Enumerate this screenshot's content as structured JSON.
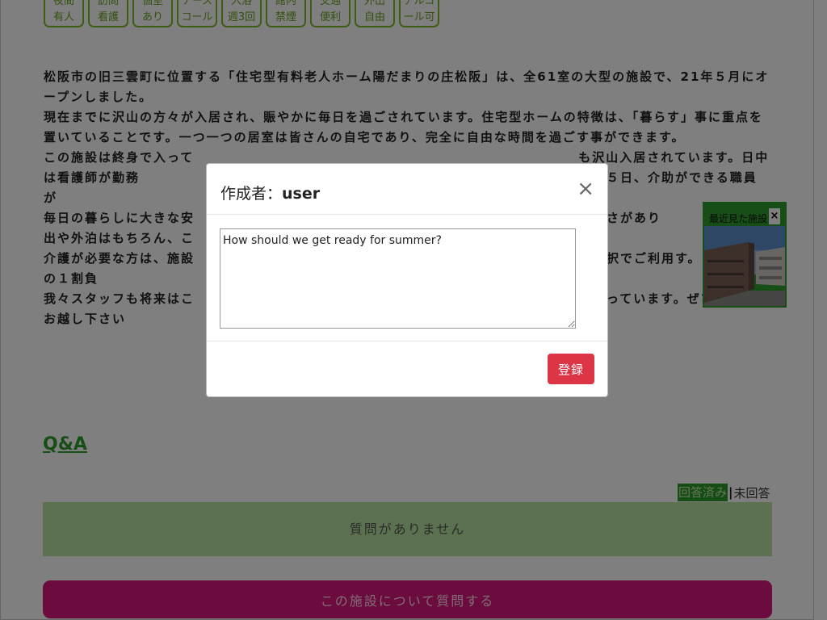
{
  "chips": [
    {
      "label": "夜間\n有人"
    },
    {
      "label": "訪問\n看護"
    },
    {
      "label": "個室\nあり"
    },
    {
      "label": "ナース\nコール"
    },
    {
      "label": "入浴\n週3回"
    },
    {
      "label": "館内\n禁煙"
    },
    {
      "label": "交通\n便利"
    },
    {
      "label": "外出\n自由"
    },
    {
      "label": "アルコ\nール可"
    }
  ],
  "description": {
    "lines": [
      "松阪市の旧三雲町に位置する「住宅型有料老人ホーム陽だまりの庄松阪」は、全61室の大型の施設で、21年５月にオープンしました。",
      "現在までに沢山の方々が入居され、賑やかに毎日を過ごされています。住宅型ホームの特徴は、「暮らす」事に重点を置いていることです。一つ一つの居室は皆さんの自宅であり、完全に自由な時間を過ごす事ができます。",
      "この施設は終身で入って　　　　　　　　　　　　　　　　　　　　　　　　　　　　も沢山入居されています。日中は看護師が勤務　　　　　　　　　　　　　　　　　　　　　　　　　。また、夜間も３６５日、介助ができる職員が",
      "毎日の暮らしに大きな安　　　　　　　　　　　　　　　　　　　　　　　　　　　　の高さがあり",
      "出や外泊はもちろん、こ",
      "介護が必要な方は、施設　　　　　　　　　　　　　　　　　　　　　　　　　　　　の選択でご利用す。（介護保険の１割負",
      "我々スタッフも将来はこ　　　　　　　　　　　　　　　　　　　　　　　　　　　　と思っています。ぜひ、見学にお越し下さい"
    ]
  },
  "qa": {
    "title": "Q&A",
    "filter_answered": "回答済み",
    "filter_separator": "|",
    "filter_unanswered": "未回答",
    "empty_message": "質問がありません",
    "ask_button": "この施設について質問する"
  },
  "recent": {
    "title": "最近見た施設",
    "close": "×",
    "image_icon": "building-photo"
  },
  "modal": {
    "title_prefix": "作成者：",
    "title_user": "user",
    "close": "×",
    "textarea_value": "How should we get ready for summer?",
    "submit_label": "登録"
  },
  "colors": {
    "chip_border": "#7fb82b",
    "qa_green": "#2e9b2e",
    "empty_bg": "#b8e2a0",
    "ask_bg": "#d8197c",
    "submit_bg": "#dc3545"
  }
}
